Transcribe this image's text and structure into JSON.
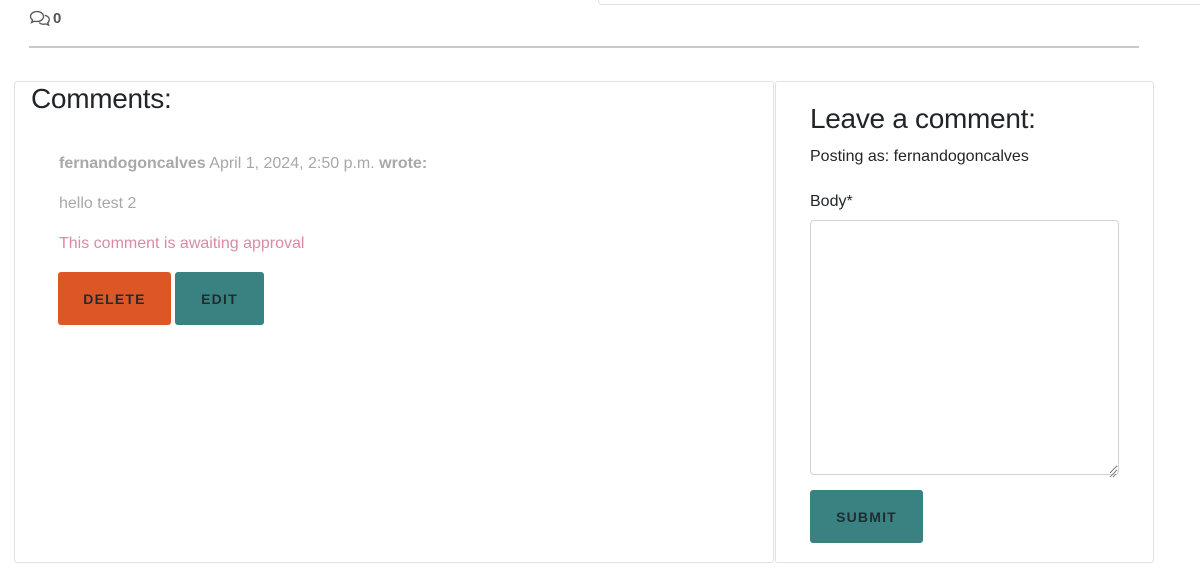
{
  "header": {
    "comment_count": "0",
    "icon": "chat-bubbles-icon"
  },
  "comments_section": {
    "title": "Comments:",
    "comments": [
      {
        "author": "fernandogoncalves",
        "date": "April 1, 2024, 2:50 p.m.",
        "wrote_label": "wrote:",
        "body": "hello test 2",
        "status": "This comment is awaiting approval",
        "delete_label": "DELETE",
        "edit_label": "EDIT"
      }
    ]
  },
  "comment_form": {
    "title": "Leave a comment:",
    "posting_as": "Posting as: fernandogoncalves",
    "body_label": "Body*",
    "body_value": "",
    "submit_label": "SUBMIT"
  },
  "colors": {
    "delete_button": "#dc5626",
    "edit_button": "#3a8182",
    "submit_button": "#3a8182",
    "awaiting_approval_text": "#d98ba4",
    "muted_text": "#a8a8a8"
  }
}
